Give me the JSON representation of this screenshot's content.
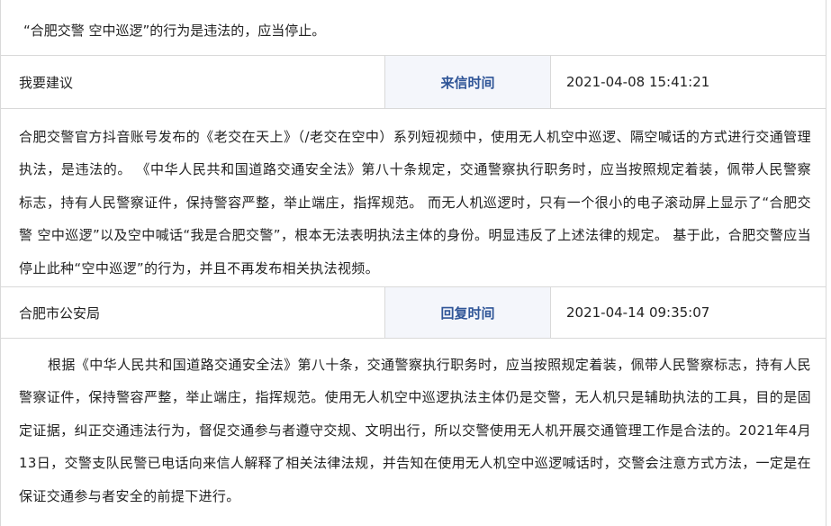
{
  "title": "“合肥交警 空中巡逻”的行为是违法的，应当停止。",
  "letter": {
    "sender": "我要建议",
    "time_label": "来信时间",
    "time": "2021-04-08 15:41:21",
    "content": "合肥交警官方抖音账号发布的《老交在天上》（/老交在空中）系列短视频中，使用无人机空中巡逻、隔空喊话的方式进行交通管理执法，是违法的。 《中华人民共和国道路交通安全法》第八十条规定，交通警察执行职务时，应当按照规定着装，佩带人民警察标志，持有人民警察证件，保持警容严整，举止端庄，指挥规范。 而无人机巡逻时，只有一个很小的电子滚动屏上显示了“合肥交警 空中巡逻”以及空中喊话“我是合肥交警”，根本无法表明执法主体的身份。明显违反了上述法律的规定。 基于此，合肥交警应当停止此种“空中巡逻”的行为，并且不再发布相关执法视频。"
  },
  "reply": {
    "replier": "合肥市公安局",
    "time_label": "回复时间",
    "time": "2021-04-14 09:35:07",
    "content": "根据《中华人民共和国道路交通安全法》第八十条，交通警察执行职务时，应当按照规定着装，佩带人民警察标志，持有人民警察证件，保持警容严整，举止端庄，指挥规范。使用无人机空中巡逻执法主体仍是交警，无人机只是辅助执法的工具，目的是固定证据，纠正交通违法行为，督促交通参与者遵守交规、文明出行，所以交警使用无人机开展交通管理工作是合法的。2021年4月13日，交警支队民警已电话向来信人解释了相关法律法规，并告知在使用无人机空中巡逻喊话时，交警会注意方式方法，一定是在保证交通参与者安全的前提下进行。"
  }
}
